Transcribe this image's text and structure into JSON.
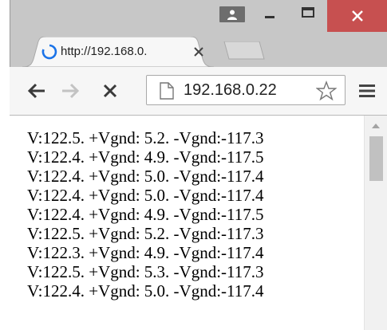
{
  "window": {
    "tab_title": "http://192.168.0.",
    "address": "192.168.0.22",
    "icons": {
      "user": "user-icon",
      "minimize": "minimize-icon",
      "maximize": "maximize-icon",
      "close": "close-icon",
      "loading": "loading-spinner-icon",
      "tab_close": "tab-close-icon",
      "back": "back-arrow-icon",
      "forward": "forward-arrow-icon",
      "stop": "stop-x-icon",
      "page": "page-icon",
      "bookmark": "star-icon",
      "menu": "hamburger-menu-icon"
    },
    "colors": {
      "close_button": "#c75050",
      "spinner": "#1a73e8"
    }
  },
  "page": {
    "lines": [
      "V:122.5. +Vgnd: 5.2. -Vgnd:-117.3",
      "V:122.4. +Vgnd: 4.9. -Vgnd:-117.5",
      "V:122.4. +Vgnd: 5.0. -Vgnd:-117.4",
      "V:122.4. +Vgnd: 5.0. -Vgnd:-117.4",
      "V:122.4. +Vgnd: 4.9. -Vgnd:-117.5",
      "V:122.5. +Vgnd: 5.2. -Vgnd:-117.3",
      "V:122.3. +Vgnd: 4.9. -Vgnd:-117.4",
      "V:122.5. +Vgnd: 5.3. -Vgnd:-117.3",
      "V:122.4. +Vgnd: 5.0. -Vgnd:-117.4"
    ]
  }
}
